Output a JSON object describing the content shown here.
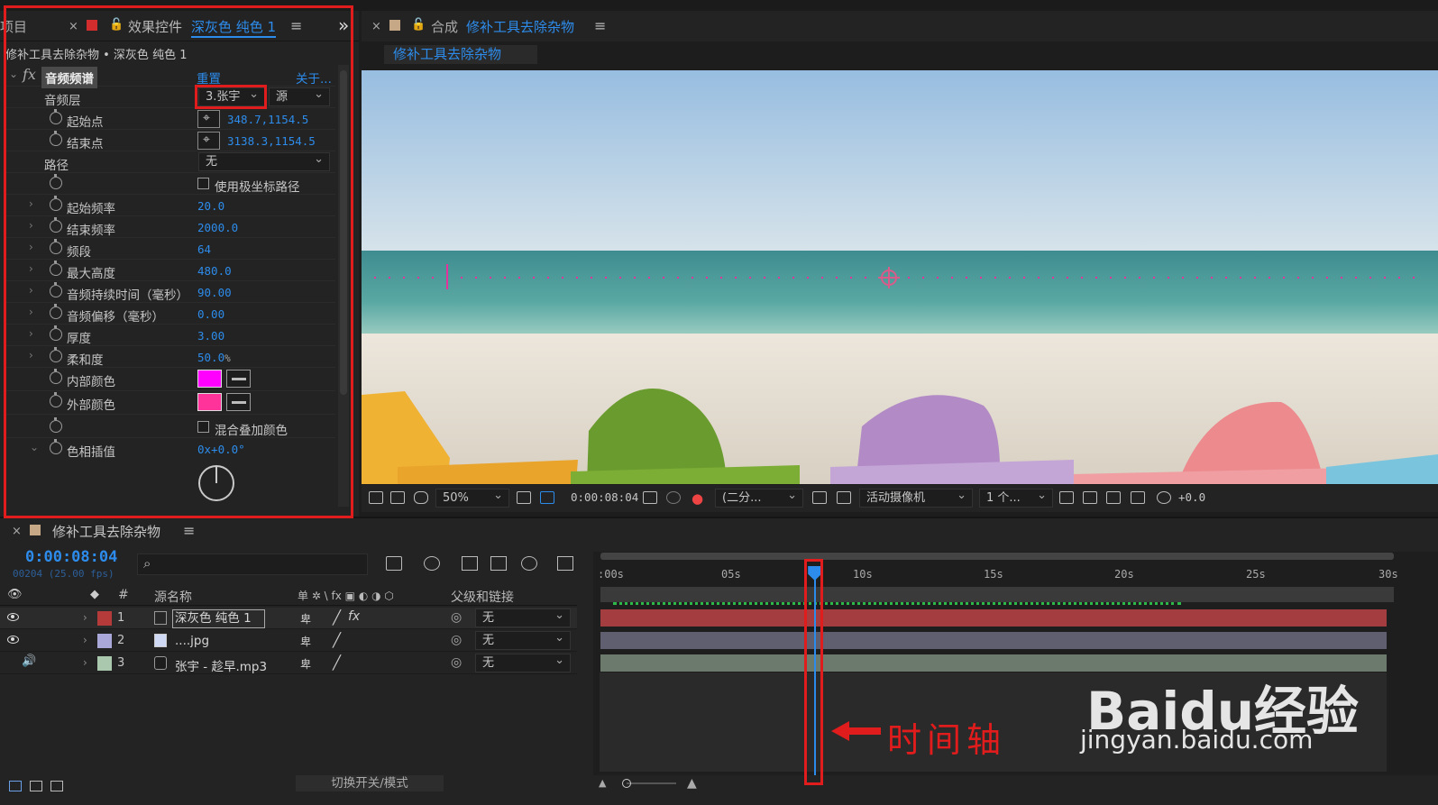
{
  "fx_panel": {
    "tab_project": "项目",
    "tab_close": "×",
    "tab_title": "效果控件",
    "tab_layer": "深灰色 纯色 1",
    "menu": "≡",
    "expand": "»",
    "breadcrumb": "修补工具去除杂物 • 深灰色 纯色 1",
    "effect_name": "音频频谱",
    "reset": "重置",
    "about": "关于...",
    "rows": [
      {
        "label": "音频层",
        "value": "3.张宇",
        "source": "源"
      },
      {
        "label": "起始点",
        "value": "348.7,1154.5"
      },
      {
        "label": "结束点",
        "value": "3138.3,1154.5"
      },
      {
        "label": "路径",
        "value": "无"
      },
      {
        "label": "",
        "value": "使用极坐标路径"
      },
      {
        "label": "起始频率",
        "value": "20.0"
      },
      {
        "label": "结束频率",
        "value": "2000.0"
      },
      {
        "label": "频段",
        "value": "64"
      },
      {
        "label": "最大高度",
        "value": "480.0"
      },
      {
        "label": "音频持续时间（毫秒）",
        "value": "90.00"
      },
      {
        "label": "音频偏移（毫秒）",
        "value": "0.00"
      },
      {
        "label": "厚度",
        "value": "3.00"
      },
      {
        "label": "柔和度",
        "value": "50.0",
        "unit": "%"
      },
      {
        "label": "内部颜色",
        "color": "#ff00ff"
      },
      {
        "label": "外部颜色",
        "color": "#ff3399"
      },
      {
        "label": "",
        "value": "混合叠加颜色"
      },
      {
        "label": "色相插值",
        "value": "+0.0°",
        "prefix": "0x"
      }
    ]
  },
  "comp": {
    "tab_close": "×",
    "tab_label": "合成",
    "tab_name": "修补工具去除杂物",
    "menu": "≡",
    "sub_tab": "修补工具去除杂物",
    "zoom": "50%",
    "timecode": "0:00:08:04",
    "resolution": "(二分...",
    "camera": "活动摄像机",
    "views": "1 个...",
    "exposure": "+0.0"
  },
  "timeline": {
    "tab_close": "×",
    "tab_name": "修补工具去除杂物",
    "menu": "≡",
    "timecode": "0:00:08:04",
    "frames": "00204 (25.00 fps)",
    "search_icon": "⌕",
    "col_number": "#",
    "col_source": "源名称",
    "col_switches": "单 ✲ \\ fx ▣ ◐ ◑ ⬡",
    "col_parent": "父级和链接",
    "layers": [
      {
        "num": "1",
        "name": "深灰色 纯色 1",
        "color": "#b53a3a",
        "parent": "无"
      },
      {
        "num": "2",
        "name": "....jpg",
        "color": "#a9a8d8",
        "parent": "无"
      },
      {
        "num": "3",
        "name": "张宇 - 趁早.mp3",
        "color": "#a9c8ae",
        "parent": "无"
      }
    ],
    "ruler": [
      ":00s",
      "05s",
      "10s",
      "15s",
      "20s",
      "25s",
      "30s"
    ],
    "playhead_seconds": 8.16,
    "duration_seconds": 30,
    "footer": "切换开关/模式",
    "annotation": "时间轴"
  },
  "watermark": {
    "brand": "Baidu经验",
    "url": "jingyan.baidu.com"
  },
  "colors": {
    "accent": "#2d8ceb",
    "highlight": "#e11c1c"
  }
}
